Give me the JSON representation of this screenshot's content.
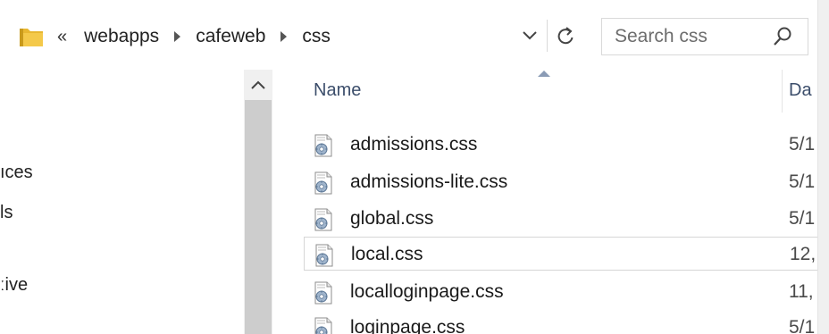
{
  "address_bar": {
    "overflow_label": "«",
    "breadcrumbs": [
      "webapps",
      "cafeweb",
      "css"
    ]
  },
  "search": {
    "placeholder": "Search css"
  },
  "nav_pane": {
    "items": [
      "ıces",
      "ls",
      "ːive"
    ]
  },
  "file_list": {
    "columns": {
      "name": "Name",
      "date": "Da"
    },
    "files": [
      {
        "name": "admissions.css",
        "date": "5/1"
      },
      {
        "name": "admissions-lite.css",
        "date": "5/1"
      },
      {
        "name": "global.css",
        "date": "5/1"
      },
      {
        "name": "local.css",
        "date": "12,",
        "selected": true
      },
      {
        "name": "localloginpage.css",
        "date": "11,"
      },
      {
        "name": "loginpage.css",
        "date": "5/1"
      }
    ]
  },
  "icons": {
    "folder": "folder-icon",
    "dropdown": "chevron-down-icon",
    "refresh": "refresh-icon",
    "search": "search-icon",
    "scroll_up": "chevron-up-icon",
    "css_file": "css-file-icon"
  },
  "colors": {
    "folder": "#e8b731",
    "header_text": "#3c4e6b",
    "selection_border": "#d6d6d6"
  }
}
